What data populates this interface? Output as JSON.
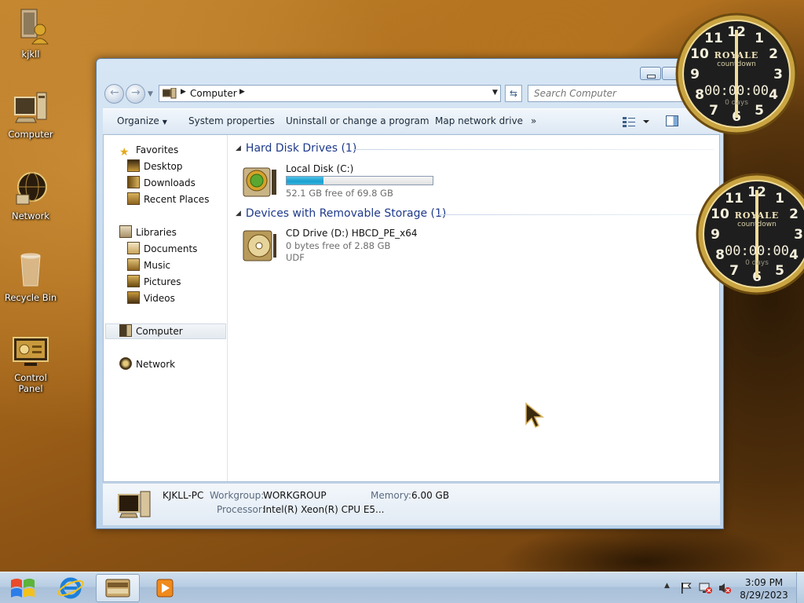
{
  "desktop": {
    "icons": [
      {
        "label": "kjkll"
      },
      {
        "label": "Computer"
      },
      {
        "label": "Network"
      },
      {
        "label": "Recycle Bin"
      },
      {
        "label": "Control Panel"
      }
    ]
  },
  "explorer": {
    "address": {
      "crumb": "Computer"
    },
    "search": {
      "placeholder": "Search Computer"
    },
    "toolbar": {
      "organize": "Organize",
      "system_properties": "System properties",
      "uninstall": "Uninstall or change a program",
      "map_drive": "Map network drive",
      "more": "»"
    },
    "nav": {
      "favorites": "Favorites",
      "desktop": "Desktop",
      "downloads": "Downloads",
      "recent": "Recent Places",
      "libraries": "Libraries",
      "documents": "Documents",
      "music": "Music",
      "pictures": "Pictures",
      "videos": "Videos",
      "computer": "Computer",
      "network": "Network"
    },
    "groups": {
      "hdd": "Hard Disk Drives (1)",
      "removable": "Devices with Removable Storage (1)"
    },
    "drives": {
      "local": {
        "name": "Local Disk (C:)",
        "free": "52.1 GB free of 69.8 GB",
        "used_fraction": 0.25
      },
      "cd": {
        "name": "CD Drive (D:) HBCD_PE_x64",
        "free": "0 bytes free of 2.88 GB",
        "fs": "UDF"
      }
    },
    "details": {
      "pc_name": "KJKLL-PC",
      "workgroup_label": "Workgroup:",
      "workgroup": "WORKGROUP",
      "memory_label": "Memory:",
      "memory": "6.00 GB",
      "processor_label": "Processor:",
      "processor": "Intel(R) Xeon(R) CPU E5..."
    }
  },
  "gadgets": [
    {
      "brand": "ROYALE",
      "sub": "countdown",
      "time": "00:00:00",
      "days": "0 days"
    },
    {
      "brand": "ROYALE",
      "sub": "countdown",
      "time": "00:00:00",
      "days": "0 days"
    }
  ],
  "taskbar": {
    "time": "3:09 PM",
    "date": "8/29/2023",
    "tray_expand": "▲"
  },
  "colors": {
    "accent_blue": "#1e3a8a",
    "capacity_fill": "#1a9fd0",
    "gold": "#c9a441"
  }
}
